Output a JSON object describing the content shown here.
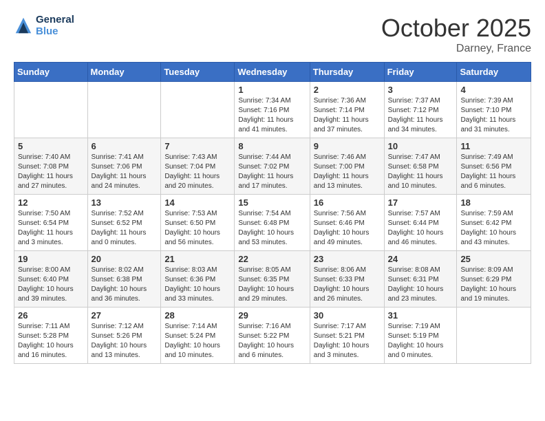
{
  "logo": {
    "line1": "General",
    "line2": "Blue"
  },
  "title": "October 2025",
  "location": "Darney, France",
  "days_header": [
    "Sunday",
    "Monday",
    "Tuesday",
    "Wednesday",
    "Thursday",
    "Friday",
    "Saturday"
  ],
  "weeks": [
    [
      {
        "day": "",
        "info": ""
      },
      {
        "day": "",
        "info": ""
      },
      {
        "day": "",
        "info": ""
      },
      {
        "day": "1",
        "info": "Sunrise: 7:34 AM\nSunset: 7:16 PM\nDaylight: 11 hours and 41 minutes."
      },
      {
        "day": "2",
        "info": "Sunrise: 7:36 AM\nSunset: 7:14 PM\nDaylight: 11 hours and 37 minutes."
      },
      {
        "day": "3",
        "info": "Sunrise: 7:37 AM\nSunset: 7:12 PM\nDaylight: 11 hours and 34 minutes."
      },
      {
        "day": "4",
        "info": "Sunrise: 7:39 AM\nSunset: 7:10 PM\nDaylight: 11 hours and 31 minutes."
      }
    ],
    [
      {
        "day": "5",
        "info": "Sunrise: 7:40 AM\nSunset: 7:08 PM\nDaylight: 11 hours and 27 minutes."
      },
      {
        "day": "6",
        "info": "Sunrise: 7:41 AM\nSunset: 7:06 PM\nDaylight: 11 hours and 24 minutes."
      },
      {
        "day": "7",
        "info": "Sunrise: 7:43 AM\nSunset: 7:04 PM\nDaylight: 11 hours and 20 minutes."
      },
      {
        "day": "8",
        "info": "Sunrise: 7:44 AM\nSunset: 7:02 PM\nDaylight: 11 hours and 17 minutes."
      },
      {
        "day": "9",
        "info": "Sunrise: 7:46 AM\nSunset: 7:00 PM\nDaylight: 11 hours and 13 minutes."
      },
      {
        "day": "10",
        "info": "Sunrise: 7:47 AM\nSunset: 6:58 PM\nDaylight: 11 hours and 10 minutes."
      },
      {
        "day": "11",
        "info": "Sunrise: 7:49 AM\nSunset: 6:56 PM\nDaylight: 11 hours and 6 minutes."
      }
    ],
    [
      {
        "day": "12",
        "info": "Sunrise: 7:50 AM\nSunset: 6:54 PM\nDaylight: 11 hours and 3 minutes."
      },
      {
        "day": "13",
        "info": "Sunrise: 7:52 AM\nSunset: 6:52 PM\nDaylight: 11 hours and 0 minutes."
      },
      {
        "day": "14",
        "info": "Sunrise: 7:53 AM\nSunset: 6:50 PM\nDaylight: 10 hours and 56 minutes."
      },
      {
        "day": "15",
        "info": "Sunrise: 7:54 AM\nSunset: 6:48 PM\nDaylight: 10 hours and 53 minutes."
      },
      {
        "day": "16",
        "info": "Sunrise: 7:56 AM\nSunset: 6:46 PM\nDaylight: 10 hours and 49 minutes."
      },
      {
        "day": "17",
        "info": "Sunrise: 7:57 AM\nSunset: 6:44 PM\nDaylight: 10 hours and 46 minutes."
      },
      {
        "day": "18",
        "info": "Sunrise: 7:59 AM\nSunset: 6:42 PM\nDaylight: 10 hours and 43 minutes."
      }
    ],
    [
      {
        "day": "19",
        "info": "Sunrise: 8:00 AM\nSunset: 6:40 PM\nDaylight: 10 hours and 39 minutes."
      },
      {
        "day": "20",
        "info": "Sunrise: 8:02 AM\nSunset: 6:38 PM\nDaylight: 10 hours and 36 minutes."
      },
      {
        "day": "21",
        "info": "Sunrise: 8:03 AM\nSunset: 6:36 PM\nDaylight: 10 hours and 33 minutes."
      },
      {
        "day": "22",
        "info": "Sunrise: 8:05 AM\nSunset: 6:35 PM\nDaylight: 10 hours and 29 minutes."
      },
      {
        "day": "23",
        "info": "Sunrise: 8:06 AM\nSunset: 6:33 PM\nDaylight: 10 hours and 26 minutes."
      },
      {
        "day": "24",
        "info": "Sunrise: 8:08 AM\nSunset: 6:31 PM\nDaylight: 10 hours and 23 minutes."
      },
      {
        "day": "25",
        "info": "Sunrise: 8:09 AM\nSunset: 6:29 PM\nDaylight: 10 hours and 19 minutes."
      }
    ],
    [
      {
        "day": "26",
        "info": "Sunrise: 7:11 AM\nSunset: 5:28 PM\nDaylight: 10 hours and 16 minutes."
      },
      {
        "day": "27",
        "info": "Sunrise: 7:12 AM\nSunset: 5:26 PM\nDaylight: 10 hours and 13 minutes."
      },
      {
        "day": "28",
        "info": "Sunrise: 7:14 AM\nSunset: 5:24 PM\nDaylight: 10 hours and 10 minutes."
      },
      {
        "day": "29",
        "info": "Sunrise: 7:16 AM\nSunset: 5:22 PM\nDaylight: 10 hours and 6 minutes."
      },
      {
        "day": "30",
        "info": "Sunrise: 7:17 AM\nSunset: 5:21 PM\nDaylight: 10 hours and 3 minutes."
      },
      {
        "day": "31",
        "info": "Sunrise: 7:19 AM\nSunset: 5:19 PM\nDaylight: 10 hours and 0 minutes."
      },
      {
        "day": "",
        "info": ""
      }
    ]
  ]
}
